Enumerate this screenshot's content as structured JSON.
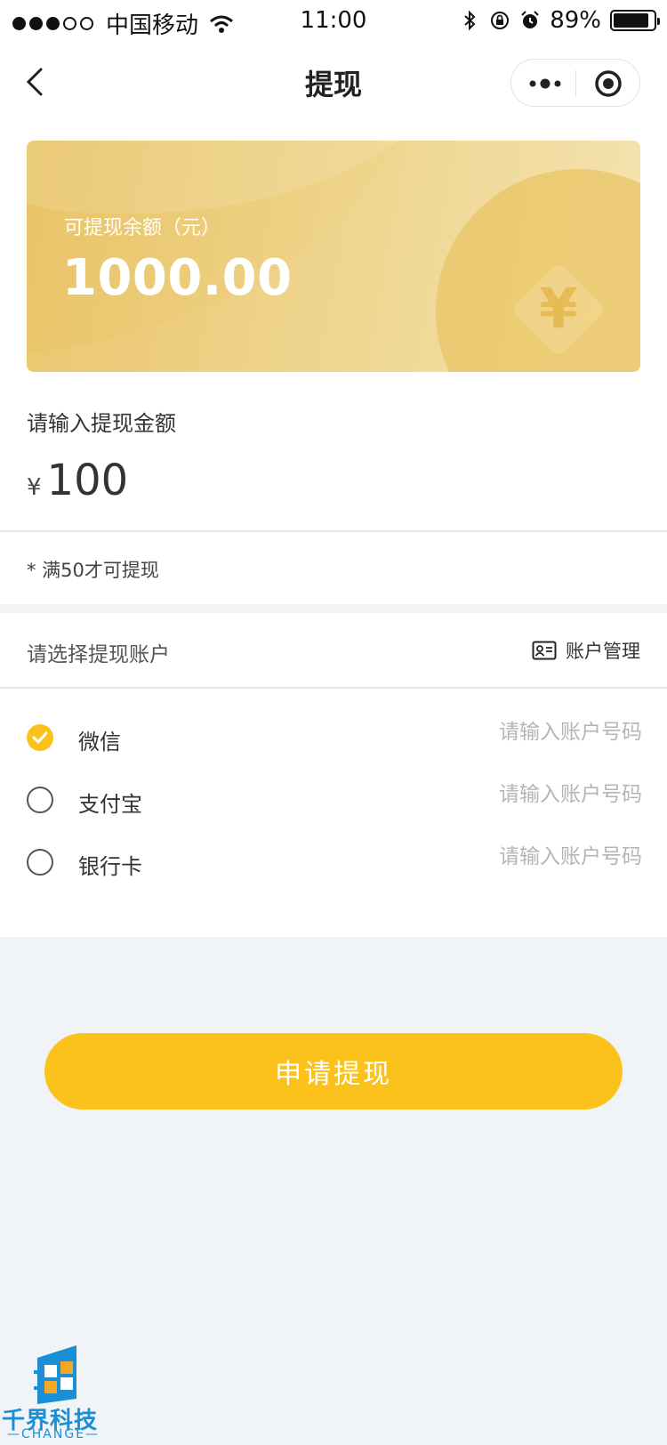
{
  "status_bar": {
    "carrier": "中国移动",
    "time": "11:00",
    "battery": "89%"
  },
  "nav": {
    "title": "提现"
  },
  "balance_card": {
    "label": "可提现余额（元）",
    "amount": "1000.00",
    "symbol": "¥"
  },
  "withdraw": {
    "title": "请输入提现金额",
    "currency": "¥",
    "amount": "100",
    "note": "* 满50才可提现"
  },
  "account": {
    "title": "请选择提现账户",
    "manage_label": "账户管理",
    "options": [
      {
        "label": "微信",
        "selected": true,
        "placeholder": "请输入账户号码"
      },
      {
        "label": "支付宝",
        "selected": false,
        "placeholder": "请输入账户号码"
      },
      {
        "label": "银行卡",
        "selected": false,
        "placeholder": "请输入账户号码"
      }
    ]
  },
  "submit_label": "申请提现",
  "watermark": {
    "name": "千界科技",
    "sub": "—CHANGE—"
  },
  "colors": {
    "accent": "#fbc21b",
    "card_gold": "#e9c466",
    "logo_blue": "#1a8fd6"
  }
}
